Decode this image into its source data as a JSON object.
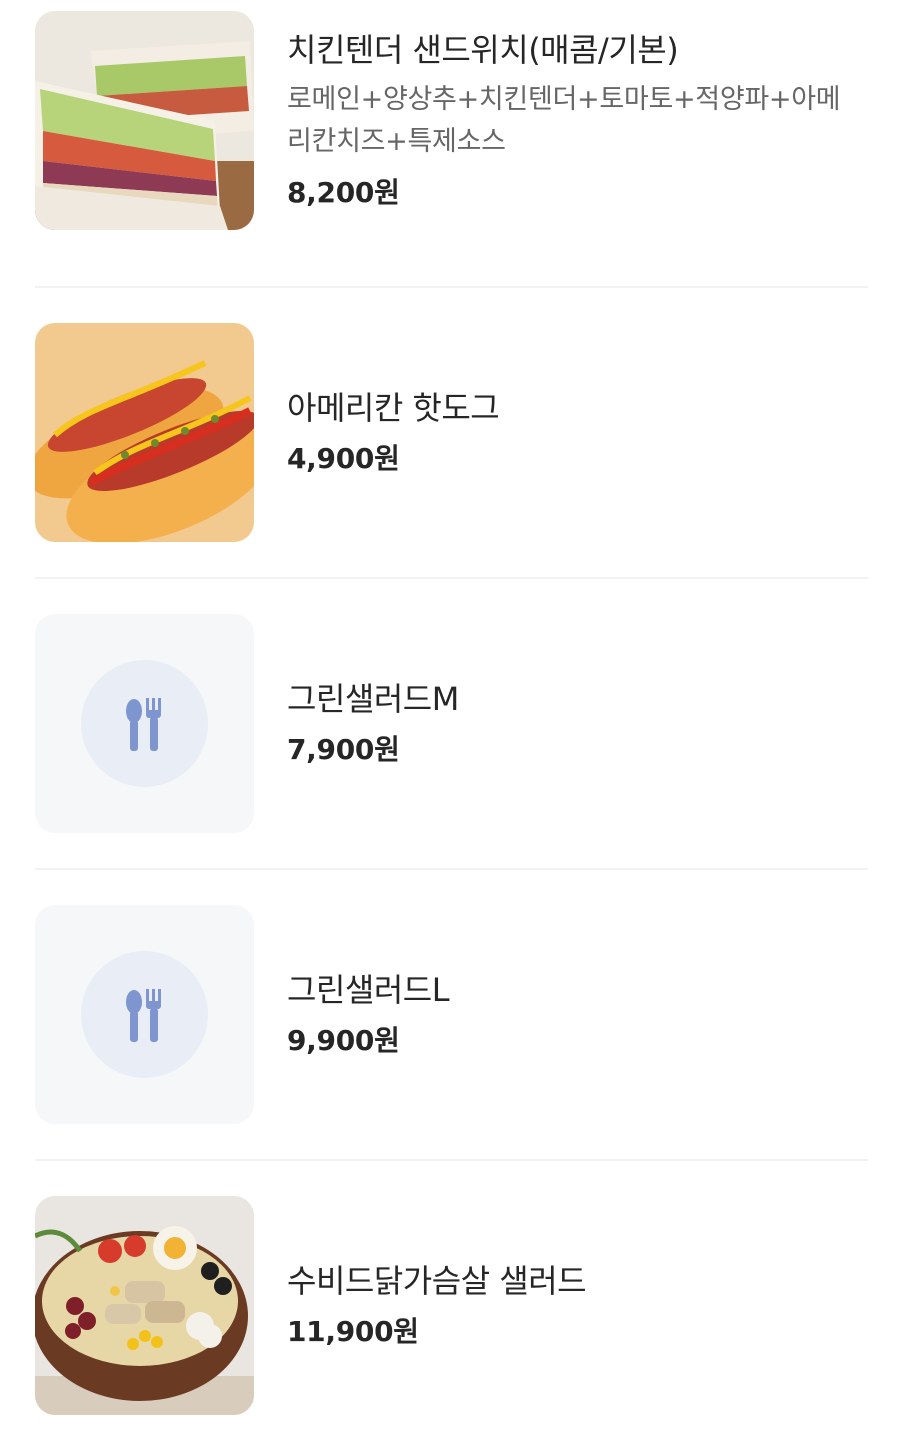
{
  "menu": {
    "items": [
      {
        "name": "치킨텐더 샌드위치(매콤/기본)",
        "description": "로메인+양상추+치킨텐더+토마토+적양파+아메리칸치즈+특제소스",
        "price": "8,200원",
        "image": "sandwich-photo"
      },
      {
        "name": "아메리칸 핫도그",
        "price": "4,900원",
        "image": "hotdog-photo"
      },
      {
        "name": "그린샐러드M",
        "price": "7,900원",
        "image": "utensils-icon"
      },
      {
        "name": "그린샐러드L",
        "price": "9,900원",
        "image": "utensils-icon"
      },
      {
        "name": "수비드닭가슴살 샐러드",
        "price": "11,900원",
        "image": "salad-bowl-photo"
      }
    ]
  },
  "colors": {
    "text_primary": "#262626",
    "text_secondary": "#666666",
    "divider": "#f1f2f4",
    "placeholder_bg": "#f6f7f9",
    "placeholder_circle": "#e9eef6",
    "utensil_icon": "#7f95cf"
  }
}
